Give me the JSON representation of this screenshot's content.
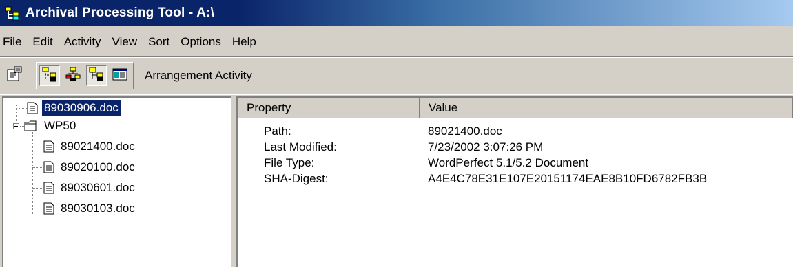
{
  "window": {
    "title": "Archival Processing Tool - A:\\"
  },
  "menu": [
    {
      "label": "File"
    },
    {
      "label": "Edit"
    },
    {
      "label": "Activity"
    },
    {
      "label": "View"
    },
    {
      "label": "Sort"
    },
    {
      "label": "Options"
    },
    {
      "label": "Help"
    }
  ],
  "toolbar": {
    "icons": [
      "properties-icon",
      "tree-icon",
      "tree-split-icon",
      "tree-active-icon",
      "list-view-icon"
    ],
    "activity_label": "Arrangement Activity"
  },
  "tree": {
    "items": [
      {
        "label": "89030906.doc",
        "type": "file",
        "selected": true
      },
      {
        "label": "WP50",
        "type": "folder",
        "expanded": true
      },
      {
        "label": "89021400.doc",
        "type": "file"
      },
      {
        "label": "89020100.doc",
        "type": "file"
      },
      {
        "label": "89030601.doc",
        "type": "file"
      },
      {
        "label": "89030103.doc",
        "type": "file"
      }
    ]
  },
  "details": {
    "columns": [
      "Property",
      "Value"
    ],
    "rows": [
      {
        "property": "Path:",
        "value": "89021400.doc"
      },
      {
        "property": "Last Modified:",
        "value": "7/23/2002 3:07:26 PM"
      },
      {
        "property": "File Type:",
        "value": "WordPerfect 5.1/5.2 Document"
      },
      {
        "property": "SHA-Digest:",
        "value": "A4E4C78E31E107E20151174EAE8B10FD6782FB3B"
      }
    ]
  },
  "colors": {
    "titlebar_start": "#0a246a",
    "titlebar_end": "#a6caf0",
    "face": "#d4d0c8",
    "selection": "#0a246a"
  }
}
